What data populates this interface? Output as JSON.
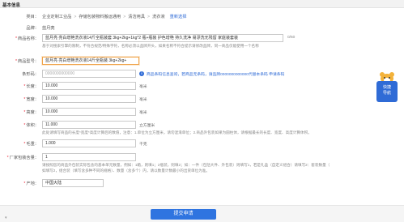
{
  "section_title": "基本信息",
  "category": {
    "label": "类目：",
    "path": [
      "企业定制工业品",
      "存储包装物料搬运通用",
      "清洁用具",
      "洗衣液"
    ],
    "reselect": "重新选择"
  },
  "brand": {
    "label": "品牌：",
    "value": "蓝月亮"
  },
  "product_name": {
    "label": "商品名称：",
    "value": "蓝月亮 亮白增艳洗衣液14斤全瓶装套 3kg+2kg+1kg*2 瓶+瓶装 护色增艳 持久洗净 易漂洗无残留 家庭装套装",
    "counter": "0/60",
    "hint": "基于对搜索引擎的限制，不符合规范/特殊字符，名称必须以品牌开头，如果名称不符合提示请修改品牌，同一商品仅能使用一个名称"
  },
  "model": {
    "label": "商品型号：",
    "value": "蓝月亮 亮白增艳洗衣液14斤全瓶装 3kg+2kg+"
  },
  "barcode": {
    "label": "条形码：",
    "placeholder": "0000000000000",
    "tip_text": "商品条码信息查询，若商品无条码，请品牌0000000000000代替本条码",
    "tip_link": "申请条码",
    "tip_icon": "info-icon"
  },
  "length": {
    "label": "长度：",
    "value": "10.000",
    "unit": "毫米"
  },
  "width": {
    "label": "宽度：",
    "value": "10.000",
    "unit": "毫米"
  },
  "height": {
    "label": "高度：",
    "value": "10.000",
    "unit": "毫米"
  },
  "volume": {
    "label": "体积：",
    "value": "11.000",
    "unit": "立方厘米",
    "hint": "此处请填写商品的长度*宽度*高度计算后的数值，注意：1.单位为立方厘米，请勿混淆单位；2.商品外包装如果为圆柱体，请根据最长的长度、宽度、高度计算体积。"
  },
  "weight": {
    "label": "毛重：",
    "value": "1.000",
    "unit": "千克"
  },
  "package_qty": {
    "label": "厂家包装含量：",
    "value": "1",
    "hint1": "请按照您的商品外包装实际包含的基本单元数量，例如：1箱，则填1；2瓶装，则填2；如：一件（包括大件、外包装）则填写1，若是礼盒（自定义组合）请填写2：套装数量（",
    "hint2": "如填写2，组合装（填写含多种不同的规格）、数量（含多个）内，请以数量计数最小的出货单位为准。"
  },
  "origin": {
    "label": "产地：",
    "value": "中国大陆"
  },
  "float_widget": {
    "line1": "快捷",
    "line2": "导航",
    "icon": "bear-mascot-icon"
  },
  "submit": {
    "label": "提交申请"
  },
  "colors": {
    "accent": "#2f74e0",
    "link": "#2f6bd6",
    "required": "#ee2233",
    "focus": "#f0a44a"
  }
}
